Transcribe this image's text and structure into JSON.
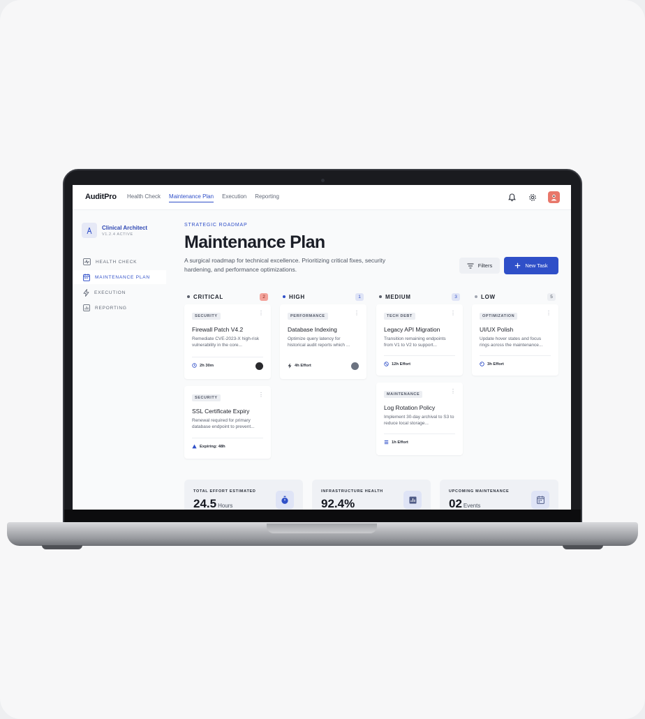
{
  "app": {
    "brand": "AuditPro",
    "nav": [
      {
        "label": "Health Check",
        "active": false
      },
      {
        "label": "Maintenance Plan",
        "active": true
      },
      {
        "label": "Execution",
        "active": false
      },
      {
        "label": "Reporting",
        "active": false
      }
    ]
  },
  "sidebar": {
    "workspace_name": "Clinical Architect",
    "workspace_version": "V1.2.4 ACTIVE",
    "items": [
      {
        "label": "HEALTH CHECK",
        "icon": "pulse-icon",
        "active": false
      },
      {
        "label": "MAINTENANCE PLAN",
        "icon": "calendar-icon",
        "active": true
      },
      {
        "label": "EXECUTION",
        "icon": "bolt-icon",
        "active": false
      },
      {
        "label": "REPORTING",
        "icon": "report-icon",
        "active": false
      }
    ]
  },
  "header": {
    "eyebrow": "STRATEGIC ROADMAP",
    "title": "Maintenance Plan",
    "description": "A surgical roadmap for technical excellence. Prioritizing critical fixes, security hardening, and performance optimizations.",
    "filters_label": "Filters",
    "new_task_label": "New Task"
  },
  "columns": [
    {
      "title": "CRITICAL",
      "count": "2",
      "dot_color": "#5b606b",
      "badge_bg": "#f3a39b",
      "badge_fg": "#8e2419",
      "cards": [
        {
          "tag": "SECURITY",
          "title": "Firewall Patch V4.2",
          "desc": "Remediate CVE-2023-X high-risk vulnerability in the core...",
          "meta": "2h 30m",
          "meta_icon": "clock-icon",
          "assignee": true
        },
        {
          "tag": "SECURITY",
          "title": "SSL Certificate Expiry",
          "desc": "Renewal required for primary database endpoint to prevent...",
          "meta": "Expiring: 48h",
          "meta_icon": "warning-icon",
          "assignee": false
        }
      ]
    },
    {
      "title": "HIGH",
      "count": "1",
      "dot_color": "#2f4fc8",
      "badge_bg": "#dfe4f6",
      "badge_fg": "#2f4fc8",
      "cards": [
        {
          "tag": "PERFORMANCE",
          "title": "Database Indexing",
          "desc": "Optimize query latency for historical audit reports which ...",
          "meta": "4h Effort",
          "meta_icon": "bolt-icon",
          "assignee": true
        }
      ]
    },
    {
      "title": "MEDIUM",
      "count": "3",
      "dot_color": "#5b606b",
      "badge_bg": "#dfe4f6",
      "badge_fg": "#2f4fc8",
      "cards": [
        {
          "tag": "TECH DEBT",
          "title": "Legacy API Migration",
          "desc": "Transition remaining endpoints from V1 to V2 to support...",
          "meta": "12h Effort",
          "meta_icon": "clock-icon",
          "assignee": false
        },
        {
          "tag": "MAINTENANCE",
          "title": "Log Rotation Policy",
          "desc": "Implement 30-day archival to S3 to reduce local storage...",
          "meta": "1h Effort",
          "meta_icon": "list-icon",
          "assignee": false
        }
      ]
    },
    {
      "title": "LOW",
      "count": "5",
      "dot_color": "#a0a5b0",
      "badge_bg": "#eceef2",
      "badge_fg": "#4e5562",
      "cards": [
        {
          "tag": "OPTIMIZATION",
          "title": "UI/UX Polish",
          "desc": "Update hover states and focus rings across the maintenance...",
          "meta": "3h Effort",
          "meta_icon": "palette-icon",
          "assignee": false
        }
      ]
    }
  ],
  "stats": [
    {
      "label": "TOTAL EFFORT ESTIMATED",
      "value": "24.5",
      "unit": "Hours",
      "icon": "stopwatch-icon"
    },
    {
      "label": "INFRASTRUCTURE HEALTH",
      "value": "92.4%",
      "unit": "",
      "icon": "chart-icon"
    },
    {
      "label": "UPCOMING MAINTENANCE",
      "value": "02",
      "unit": "Events",
      "icon": "calendar-icon"
    }
  ],
  "colors": {
    "accent": "#2f4fc8",
    "critical": "#f3a39b"
  }
}
